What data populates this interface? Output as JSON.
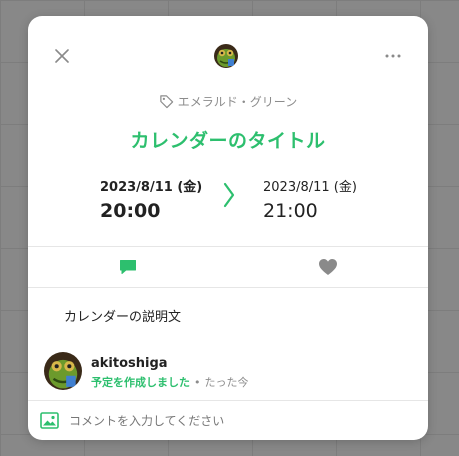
{
  "colors": {
    "accent": "#2dbf6e",
    "muted": "#8c8c8c"
  },
  "header": {
    "close_icon": "close-icon",
    "more_icon": "more-horizontal-icon"
  },
  "tag": {
    "icon": "tag-icon",
    "label": "エメラルド・グリーン"
  },
  "event": {
    "title": "カレンダーのタイトル",
    "start": {
      "date": "2023/8/11 (金)",
      "time": "20:00"
    },
    "end": {
      "date": "2023/8/11 (金)",
      "time": "21:00"
    },
    "arrow_icon": "chevron-right-icon"
  },
  "tabs": [
    {
      "name": "comments",
      "icon": "comment-icon",
      "active": true
    },
    {
      "name": "likes",
      "icon": "heart-icon",
      "active": false
    }
  ],
  "description": "カレンダーの説明文",
  "activity": {
    "user": "akitoshiga",
    "action": "予定を作成しました",
    "separator": "•",
    "time": "たった今"
  },
  "comment": {
    "icon": "image-icon",
    "placeholder": "コメントを入力してください"
  }
}
